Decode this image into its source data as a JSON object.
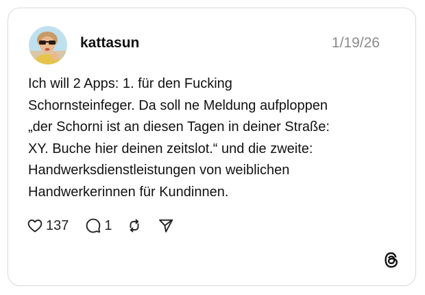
{
  "post": {
    "username": "kattasun",
    "date": "1/19/26",
    "text_lines": [
      "Ich will 2 Apps: 1. für den Fucking",
      "Schornsteinfeger. Da soll ne Meldung aufploppen",
      "„der Schorni ist an diesen Tagen in deiner Straße:",
      "XY. Buche hier deinen zeitslot.“ und die zweite:",
      "Handwerksdienstleistungen von weiblichen",
      "Handwerkerinnen für Kundinnen."
    ],
    "likes": "137",
    "replies": "1"
  },
  "icons": {
    "like": "heart-icon",
    "reply": "comment-bubble-icon",
    "repost": "repost-icon",
    "share": "send-icon",
    "brand": "threads-logo-icon"
  }
}
